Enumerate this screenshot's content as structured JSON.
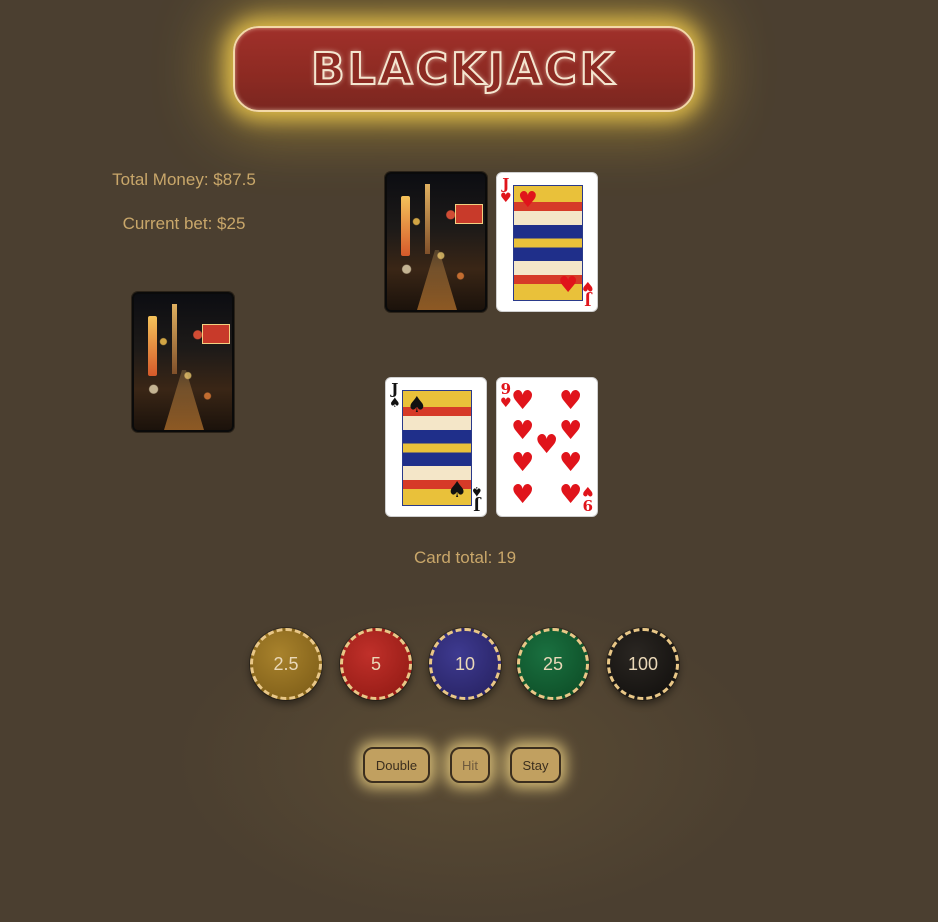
{
  "title": "BLACKJACK",
  "player_info": {
    "total_money": "Total Money: $87.5",
    "current_bet": "Current bet: $25"
  },
  "deck": {
    "label": "deck"
  },
  "dealer": {
    "cards": [
      {
        "face": "down"
      },
      {
        "rank": "J",
        "suit": "♥",
        "color": "red"
      }
    ]
  },
  "player": {
    "cards": [
      {
        "rank": "J",
        "suit": "♠",
        "color": "black"
      },
      {
        "rank": "9",
        "suit": "♥",
        "color": "red"
      }
    ],
    "card_total": "Card total: 19"
  },
  "chips": [
    {
      "label": "2.5",
      "color": "#8b6a1c"
    },
    {
      "label": "5",
      "color": "#a8201a"
    },
    {
      "label": "10",
      "color": "#2f2a78"
    },
    {
      "label": "25",
      "color": "#0f5a2e"
    },
    {
      "label": "100",
      "color": "#1a1714"
    }
  ],
  "actions": {
    "double": "Double",
    "hit": "Hit",
    "stay": "Stay"
  }
}
